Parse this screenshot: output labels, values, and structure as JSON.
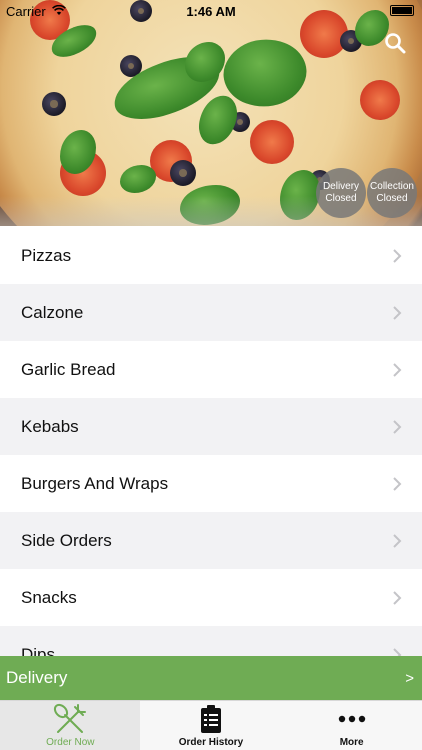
{
  "status_bar": {
    "carrier": "Carrier",
    "time": "1:46 AM"
  },
  "hero": {
    "search_icon": "search-icon",
    "delivery_badge": {
      "line1": "Delivery",
      "line2": "Closed"
    },
    "collection_badge": {
      "line1": "Collection",
      "line2": "Closed"
    }
  },
  "menu": {
    "items": [
      {
        "label": "Pizzas"
      },
      {
        "label": "Calzone"
      },
      {
        "label": "Garlic Bread"
      },
      {
        "label": "Kebabs"
      },
      {
        "label": "Burgers And Wraps"
      },
      {
        "label": "Side Orders"
      },
      {
        "label": "Snacks"
      },
      {
        "label": "Dips"
      }
    ]
  },
  "delivery_bar": {
    "label": "Delivery",
    "arrow": ">"
  },
  "tab_bar": {
    "tabs": [
      {
        "label": "Order Now",
        "icon": "fork-knife-icon",
        "active": true
      },
      {
        "label": "Order History",
        "icon": "clipboard-icon",
        "active": false
      },
      {
        "label": "More",
        "icon": "more-dots-icon",
        "active": false
      }
    ]
  },
  "colors": {
    "accent": "#6fac54",
    "badge": "#787878"
  }
}
